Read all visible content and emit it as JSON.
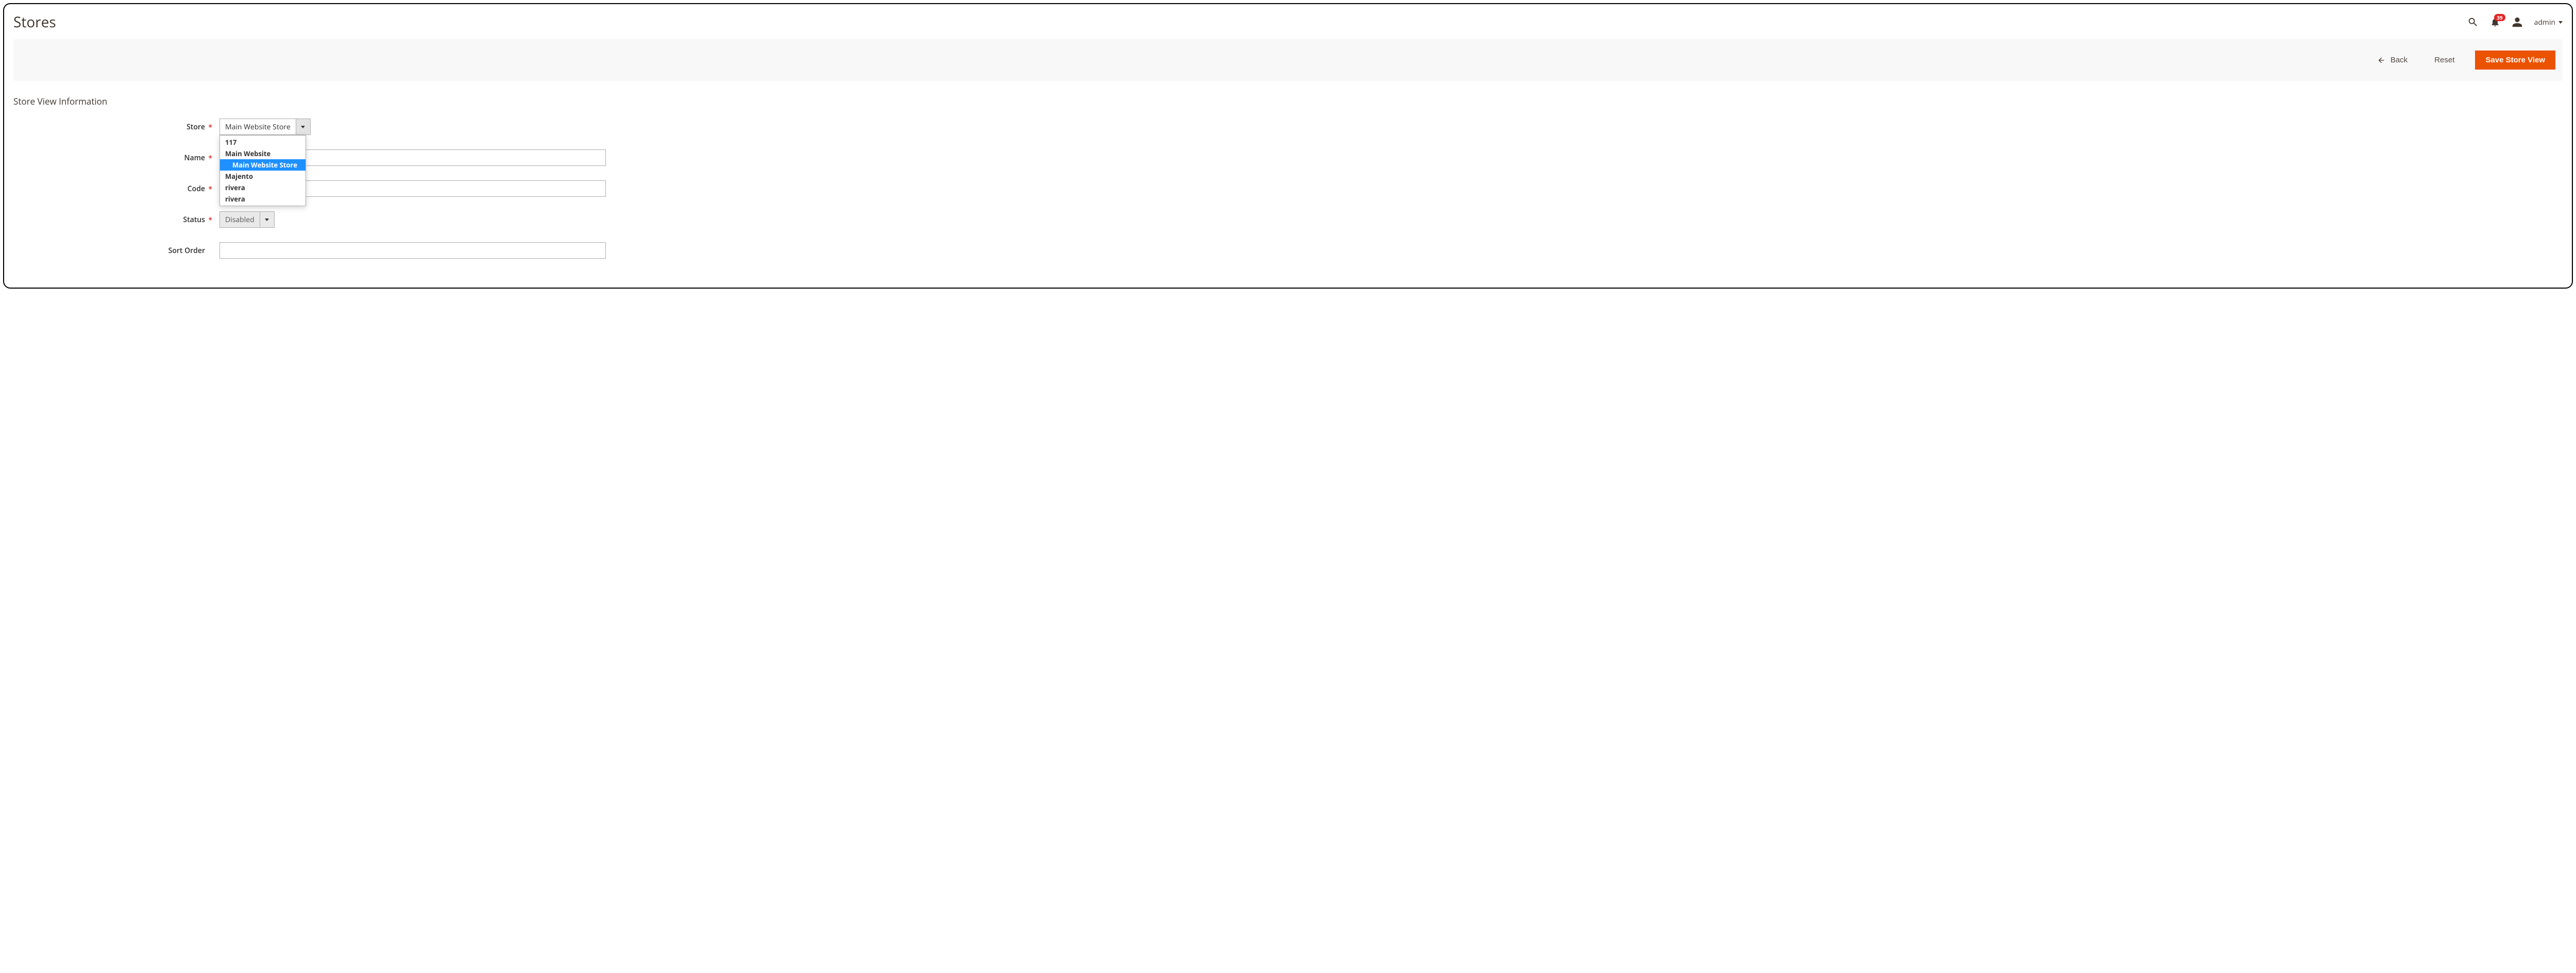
{
  "header": {
    "title": "Stores",
    "notification_count": "39",
    "user_name": "admin"
  },
  "actions": {
    "back": "Back",
    "reset": "Reset",
    "save": "Save Store View"
  },
  "section_title": "Store View Information",
  "form": {
    "store": {
      "label": "Store",
      "value": "Main Website Store",
      "options": [
        {
          "type": "group",
          "label": "117"
        },
        {
          "type": "group",
          "label": "Main Website"
        },
        {
          "type": "option",
          "label": "Main Website Store",
          "selected": true,
          "indent": true
        },
        {
          "type": "group",
          "label": "Majento"
        },
        {
          "type": "group",
          "label": "rivera"
        },
        {
          "type": "group",
          "label": "rivera"
        }
      ]
    },
    "name": {
      "label": "Name",
      "value": ""
    },
    "code": {
      "label": "Code",
      "value": ""
    },
    "status": {
      "label": "Status",
      "value": "Disabled"
    },
    "sort_order": {
      "label": "Sort Order",
      "value": ""
    }
  }
}
